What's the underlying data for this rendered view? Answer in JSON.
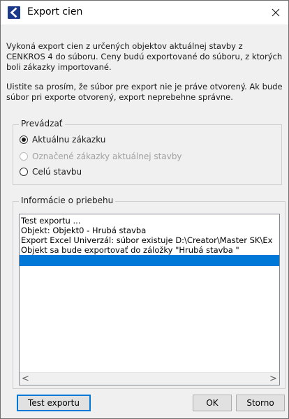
{
  "window": {
    "title": "Export cien",
    "accent": "#0078d7"
  },
  "description": {
    "paragraph1": "Vykoná export cien z určených objektov aktuálnej stavby z CENKROS 4 do súboru. Ceny budú exportované do súboru, z ktorých boli zákazky importované.",
    "paragraph2": "Uistite sa prosím, že súbor pre export nie je práve otvorený. Ak bude súbor pri exporte otvorený, export neprebehne správne."
  },
  "process_group": {
    "legend": "Prevádzať",
    "options": [
      {
        "label": "Aktuálnu zákazku",
        "checked": true,
        "enabled": true
      },
      {
        "label": "Označené zákazky aktuálnej stavby",
        "checked": false,
        "enabled": false
      },
      {
        "label": "Celú stavbu",
        "checked": false,
        "enabled": true
      }
    ]
  },
  "info_group": {
    "legend": "Informácie o priebehu",
    "log_lines": [
      "Test exportu ...",
      "Objekt: Objekt0 - Hrubá stavba",
      "Export Excel Univerzál: súbor existuje D:\\Creator\\Master SK\\Ex",
      "Objekt sa bude exportovať do záložky \"Hrubá stavba \""
    ],
    "scroll_left": "<",
    "scroll_right": ">"
  },
  "buttons": {
    "test": "Test exportu",
    "ok": "OK",
    "cancel": "Storno"
  },
  "icons": {
    "app": "export-app-icon",
    "close": "close-icon"
  }
}
